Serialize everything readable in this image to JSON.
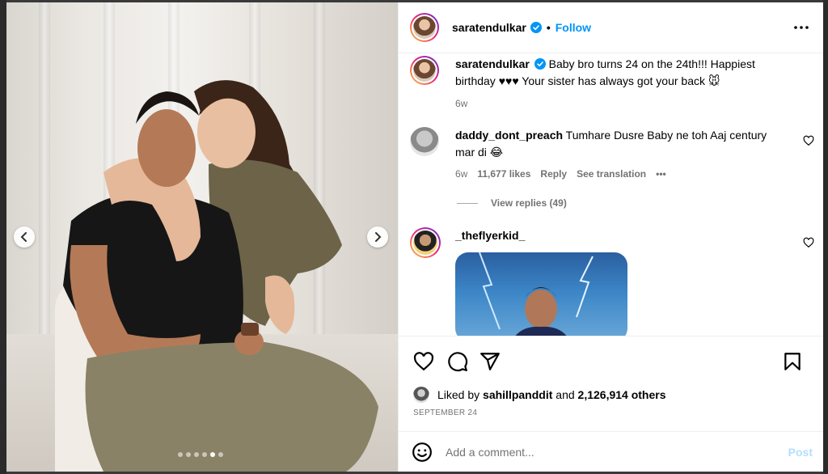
{
  "post": {
    "username": "saratendulkar",
    "follow_label": "Follow",
    "separator": "•",
    "caption_user": "saratendulkar",
    "caption_text": "Baby bro turns 24 on the 24th!!! Happiest birthday ♥♥♥ Your sister has always got your back 🐭",
    "caption_time": "6w",
    "carousel": {
      "total_slides": 6,
      "active_index": 4
    }
  },
  "comments": [
    {
      "username": "daddy_dont_preach",
      "text": "Tumhare Dusre Baby ne toh Aaj century mar di 😂",
      "time": "6w",
      "likes": "11,677 likes",
      "reply_label": "Reply",
      "translate_label": "See translation",
      "more": "•••",
      "view_replies": "View replies (49)"
    },
    {
      "username": "_theflyerkid_",
      "has_gif": true
    }
  ],
  "likes": {
    "liked_by_prefix": "Liked by",
    "liked_by_user": "sahillpanddit",
    "and": "and",
    "others": "2,126,914 others"
  },
  "date": "SEPTEMBER 24",
  "compose": {
    "placeholder": "Add a comment...",
    "post_label": "Post"
  },
  "icons": {
    "verified": "verified-badge-icon",
    "more": "more-options-icon",
    "like": "heart-icon",
    "comment": "comment-icon",
    "share": "share-icon",
    "save": "bookmark-icon",
    "emoji": "emoji-icon",
    "prev": "chevron-left-icon",
    "next": "chevron-right-icon"
  },
  "colors": {
    "link_blue": "#0095f6",
    "post_disabled": "#b2dffc",
    "meta_gray": "#737373"
  }
}
